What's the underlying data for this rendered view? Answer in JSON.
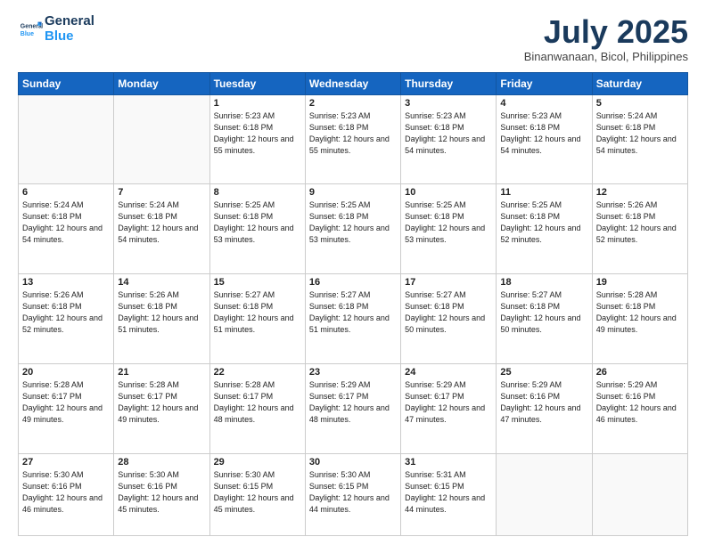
{
  "header": {
    "logo_line1": "General",
    "logo_line2": "Blue",
    "month_title": "July 2025",
    "location": "Binanwanaan, Bicol, Philippines"
  },
  "weekdays": [
    "Sunday",
    "Monday",
    "Tuesday",
    "Wednesday",
    "Thursday",
    "Friday",
    "Saturday"
  ],
  "weeks": [
    [
      {
        "day": "",
        "info": ""
      },
      {
        "day": "",
        "info": ""
      },
      {
        "day": "1",
        "info": "Sunrise: 5:23 AM\nSunset: 6:18 PM\nDaylight: 12 hours and 55 minutes."
      },
      {
        "day": "2",
        "info": "Sunrise: 5:23 AM\nSunset: 6:18 PM\nDaylight: 12 hours and 55 minutes."
      },
      {
        "day": "3",
        "info": "Sunrise: 5:23 AM\nSunset: 6:18 PM\nDaylight: 12 hours and 54 minutes."
      },
      {
        "day": "4",
        "info": "Sunrise: 5:23 AM\nSunset: 6:18 PM\nDaylight: 12 hours and 54 minutes."
      },
      {
        "day": "5",
        "info": "Sunrise: 5:24 AM\nSunset: 6:18 PM\nDaylight: 12 hours and 54 minutes."
      }
    ],
    [
      {
        "day": "6",
        "info": "Sunrise: 5:24 AM\nSunset: 6:18 PM\nDaylight: 12 hours and 54 minutes."
      },
      {
        "day": "7",
        "info": "Sunrise: 5:24 AM\nSunset: 6:18 PM\nDaylight: 12 hours and 54 minutes."
      },
      {
        "day": "8",
        "info": "Sunrise: 5:25 AM\nSunset: 6:18 PM\nDaylight: 12 hours and 53 minutes."
      },
      {
        "day": "9",
        "info": "Sunrise: 5:25 AM\nSunset: 6:18 PM\nDaylight: 12 hours and 53 minutes."
      },
      {
        "day": "10",
        "info": "Sunrise: 5:25 AM\nSunset: 6:18 PM\nDaylight: 12 hours and 53 minutes."
      },
      {
        "day": "11",
        "info": "Sunrise: 5:25 AM\nSunset: 6:18 PM\nDaylight: 12 hours and 52 minutes."
      },
      {
        "day": "12",
        "info": "Sunrise: 5:26 AM\nSunset: 6:18 PM\nDaylight: 12 hours and 52 minutes."
      }
    ],
    [
      {
        "day": "13",
        "info": "Sunrise: 5:26 AM\nSunset: 6:18 PM\nDaylight: 12 hours and 52 minutes."
      },
      {
        "day": "14",
        "info": "Sunrise: 5:26 AM\nSunset: 6:18 PM\nDaylight: 12 hours and 51 minutes."
      },
      {
        "day": "15",
        "info": "Sunrise: 5:27 AM\nSunset: 6:18 PM\nDaylight: 12 hours and 51 minutes."
      },
      {
        "day": "16",
        "info": "Sunrise: 5:27 AM\nSunset: 6:18 PM\nDaylight: 12 hours and 51 minutes."
      },
      {
        "day": "17",
        "info": "Sunrise: 5:27 AM\nSunset: 6:18 PM\nDaylight: 12 hours and 50 minutes."
      },
      {
        "day": "18",
        "info": "Sunrise: 5:27 AM\nSunset: 6:18 PM\nDaylight: 12 hours and 50 minutes."
      },
      {
        "day": "19",
        "info": "Sunrise: 5:28 AM\nSunset: 6:18 PM\nDaylight: 12 hours and 49 minutes."
      }
    ],
    [
      {
        "day": "20",
        "info": "Sunrise: 5:28 AM\nSunset: 6:17 PM\nDaylight: 12 hours and 49 minutes."
      },
      {
        "day": "21",
        "info": "Sunrise: 5:28 AM\nSunset: 6:17 PM\nDaylight: 12 hours and 49 minutes."
      },
      {
        "day": "22",
        "info": "Sunrise: 5:28 AM\nSunset: 6:17 PM\nDaylight: 12 hours and 48 minutes."
      },
      {
        "day": "23",
        "info": "Sunrise: 5:29 AM\nSunset: 6:17 PM\nDaylight: 12 hours and 48 minutes."
      },
      {
        "day": "24",
        "info": "Sunrise: 5:29 AM\nSunset: 6:17 PM\nDaylight: 12 hours and 47 minutes."
      },
      {
        "day": "25",
        "info": "Sunrise: 5:29 AM\nSunset: 6:16 PM\nDaylight: 12 hours and 47 minutes."
      },
      {
        "day": "26",
        "info": "Sunrise: 5:29 AM\nSunset: 6:16 PM\nDaylight: 12 hours and 46 minutes."
      }
    ],
    [
      {
        "day": "27",
        "info": "Sunrise: 5:30 AM\nSunset: 6:16 PM\nDaylight: 12 hours and 46 minutes."
      },
      {
        "day": "28",
        "info": "Sunrise: 5:30 AM\nSunset: 6:16 PM\nDaylight: 12 hours and 45 minutes."
      },
      {
        "day": "29",
        "info": "Sunrise: 5:30 AM\nSunset: 6:15 PM\nDaylight: 12 hours and 45 minutes."
      },
      {
        "day": "30",
        "info": "Sunrise: 5:30 AM\nSunset: 6:15 PM\nDaylight: 12 hours and 44 minutes."
      },
      {
        "day": "31",
        "info": "Sunrise: 5:31 AM\nSunset: 6:15 PM\nDaylight: 12 hours and 44 minutes."
      },
      {
        "day": "",
        "info": ""
      },
      {
        "day": "",
        "info": ""
      }
    ]
  ]
}
